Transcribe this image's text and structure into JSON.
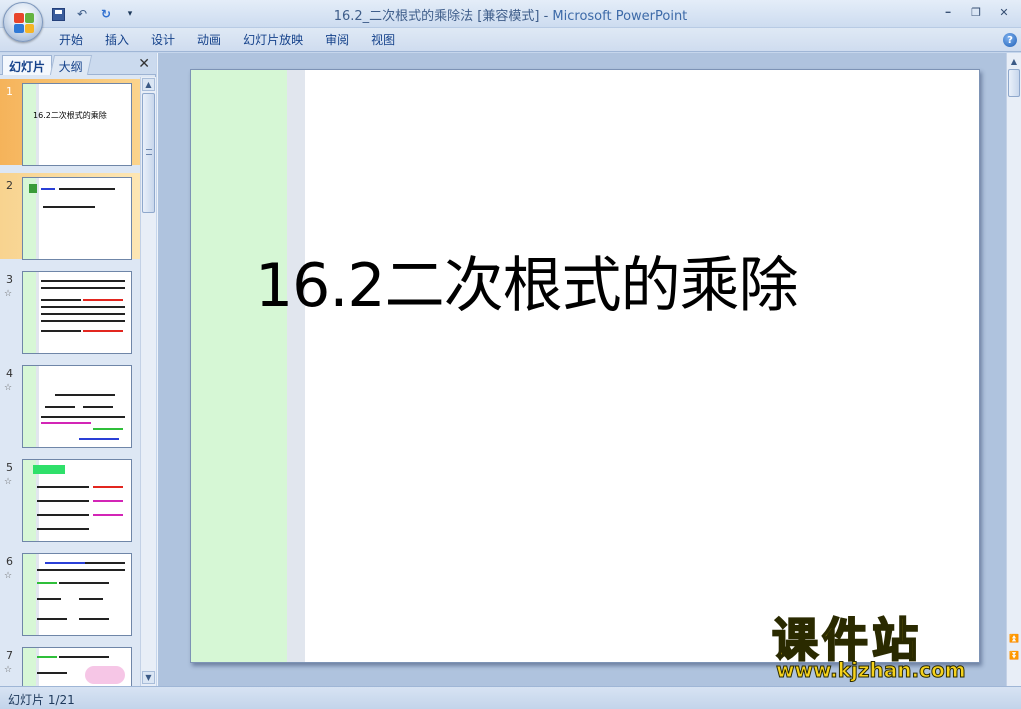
{
  "window": {
    "title_doc": "16.2_二次根式的乘除法 [兼容模式]",
    "title_sep": " - ",
    "title_app": "Microsoft PowerPoint",
    "minimize_label": "━",
    "restore_label": "❐",
    "close_label": "✕"
  },
  "qat": {
    "undo_label": "↶",
    "redo_label": "↻",
    "customize_label": "▾"
  },
  "ribbon": {
    "tabs": [
      {
        "label": "开始"
      },
      {
        "label": "插入"
      },
      {
        "label": "设计"
      },
      {
        "label": "动画"
      },
      {
        "label": "幻灯片放映"
      },
      {
        "label": "审阅"
      },
      {
        "label": "视图"
      }
    ],
    "help_label": "?"
  },
  "pane": {
    "tab_slides": "幻灯片",
    "tab_outline": "大纲",
    "close_label": "✕"
  },
  "thumbnails": [
    {
      "number": "1",
      "title": "16.2二次根式的乘除",
      "selected": true
    },
    {
      "number": "2",
      "selected": false
    },
    {
      "number": "3",
      "anim": "☆"
    },
    {
      "number": "4",
      "anim": "☆"
    },
    {
      "number": "5",
      "anim": "☆"
    },
    {
      "number": "6",
      "anim": "☆"
    },
    {
      "number": "7",
      "anim": "☆"
    }
  ],
  "slide": {
    "title": "16.2二次根式的乘除"
  },
  "watermark": {
    "text_cn": "课件站",
    "url": "www.kjzhan.com"
  },
  "status": {
    "slide_info": "幻灯片 1/21"
  },
  "colors": {
    "selected_thumb": "#f5b35a",
    "slide_sidebar": "#d6f7d5",
    "workspace": "#afc3de",
    "watermark": "#f6d21b"
  }
}
